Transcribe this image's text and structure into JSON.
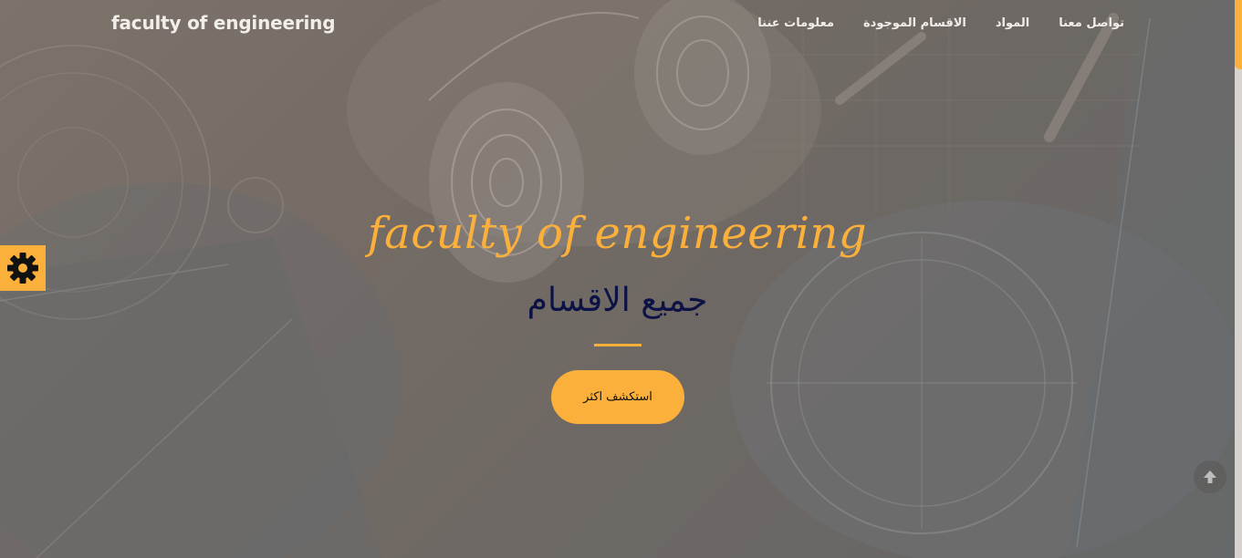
{
  "navbar": {
    "brand": "faculty of engineering",
    "links": [
      {
        "label": "تواصل معنا"
      },
      {
        "label": "المواد"
      },
      {
        "label": "الاقسام الموجودة"
      },
      {
        "label": "معلومات عننا"
      }
    ]
  },
  "hero": {
    "title": "faculty of engineering",
    "subtitle": "جميع الاقسام",
    "cta_label": "استكشف اكثر"
  },
  "icons": {
    "settings": "gear-icon",
    "scroll_top": "arrow-up-circle-icon"
  },
  "colors": {
    "accent": "#fbb03b",
    "subtitle": "#0d1246",
    "nav_text": "#f1ede9"
  }
}
